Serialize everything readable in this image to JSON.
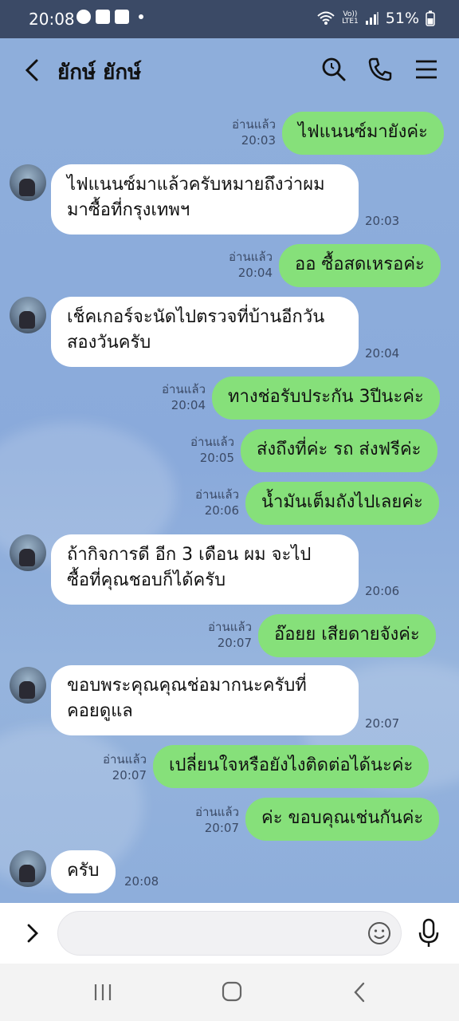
{
  "status_bar": {
    "time": "20:08",
    "network_label": "Vo))\nLTE1",
    "battery": "51%"
  },
  "header": {
    "title": "ยักษ์ ยักษ์",
    "icons": [
      "back-icon",
      "search-icon",
      "phone-icon",
      "menu-icon"
    ]
  },
  "messages": [
    {
      "dir": "out",
      "text": "ไฟแนนซ์มายังค่ะ",
      "read": "อ่านแล้ว",
      "time": "20:03"
    },
    {
      "dir": "in",
      "text_lines": [
        "ไฟแนนซ์มาแล้วครับหมายถึงว่าผม",
        "มาซื้อที่กรุงเทพฯ"
      ],
      "time": "20:03"
    },
    {
      "dir": "out",
      "text": "ออ ซื้อสดเหรอค่ะ",
      "read": "อ่านแล้ว",
      "time": "20:04"
    },
    {
      "dir": "in",
      "text_lines": [
        "เช็คเกอร์จะนัดไปตรวจที่บ้านอีกวัน",
        "สองวันครับ"
      ],
      "time": "20:04"
    },
    {
      "dir": "out",
      "text": "ทางช่อรับประกัน 3ปีนะค่ะ",
      "read": "อ่านแล้ว",
      "time": "20:04"
    },
    {
      "dir": "out",
      "text": "ส่งถึงที่ค่ะ รถ ส่งฟรีค่ะ",
      "read": "อ่านแล้ว",
      "time": "20:05"
    },
    {
      "dir": "out",
      "text": "น้ำมันเต็มถังไปเลยค่ะ",
      "read": "อ่านแล้ว",
      "time": "20:06"
    },
    {
      "dir": "in",
      "text_lines": [
        "ถ้ากิจการดี อีก 3 เดือน ผม จะไป",
        "ซื้อที่คุณชอบก็ได้ครับ"
      ],
      "time": "20:06"
    },
    {
      "dir": "out",
      "text": "อ๊อยย เสียดายจังค่ะ",
      "read": "อ่านแล้ว",
      "time": "20:07"
    },
    {
      "dir": "in",
      "text_lines": [
        "ขอบพระคุณคุณช่อมากนะครับที่",
        "คอยดูแล"
      ],
      "time": "20:07"
    },
    {
      "dir": "out",
      "text": "เปลี่ยนใจหรือยังไงติดต่อได้นะค่ะ",
      "read": "อ่านแล้ว",
      "time": "20:07"
    },
    {
      "dir": "out",
      "text": "ค่ะ ขอบคุณเช่นกันค่ะ",
      "read": "อ่านแล้ว",
      "time": "20:07"
    },
    {
      "dir": "in",
      "text_lines": [
        "ครับ"
      ],
      "time": "20:08"
    }
  ],
  "input": {
    "placeholder": "",
    "icons": [
      "expand-icon",
      "emoji-icon",
      "mic-icon"
    ]
  },
  "nav": {
    "icons": [
      "recents-icon",
      "home-icon",
      "back-nav-icon"
    ]
  },
  "colors": {
    "chat_bg": "#8eaedb",
    "outgoing_bubble": "#86e07a",
    "incoming_bubble": "#ffffff",
    "status_bar": "#3b4a66"
  }
}
